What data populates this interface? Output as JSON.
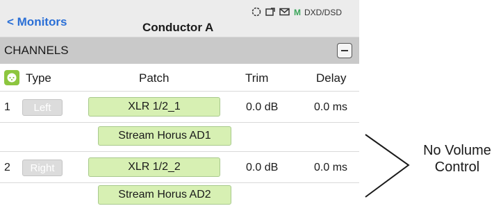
{
  "header": {
    "back_label": "< Monitors",
    "title": "Conductor A",
    "status": {
      "icons": [
        "dial-icon",
        "window-icon",
        "mail-icon"
      ],
      "m_label": "M",
      "format": "DXD/DSD"
    }
  },
  "channels_section": {
    "title": "CHANNELS",
    "collapse_symbol": "minus"
  },
  "columns": {
    "type": "Type",
    "patch": "Patch",
    "trim": "Trim",
    "delay": "Delay"
  },
  "channels": [
    {
      "number": "1",
      "type": "Left",
      "patch": "XLR 1/2_1",
      "trim": "0.0 dB",
      "delay": "0.0 ms",
      "stream": "Stream Horus AD1"
    },
    {
      "number": "2",
      "type": "Right",
      "patch": "XLR 1/2_2",
      "trim": "0.0 dB",
      "delay": "0.0 ms",
      "stream": "Stream Horus AD2"
    }
  ],
  "annotation": {
    "line1": "No Volume",
    "line2": "Control"
  },
  "colors": {
    "accent": "#2a6fd6",
    "patch_fill": "#d7f0b3",
    "status_green": "#3aa55a",
    "type_icon": "#8dc63f"
  }
}
